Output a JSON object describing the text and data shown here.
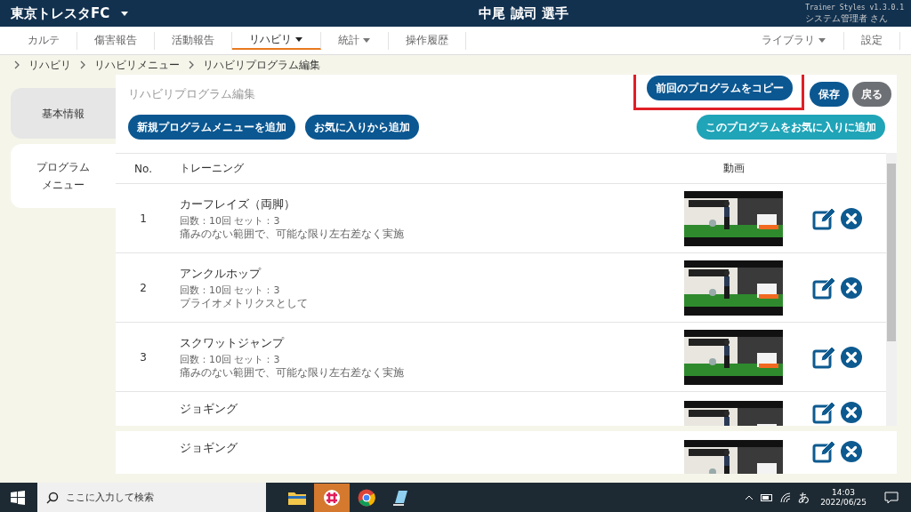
{
  "header": {
    "team": "東京トレスタFC",
    "player": "中尾 誠司 選手",
    "version": "Trainer Styles v1.3.0.1",
    "user": "システム管理者 さん"
  },
  "nav": {
    "left": [
      {
        "label": "カルテ",
        "selected": false,
        "dropdown": false
      },
      {
        "label": "傷害報告",
        "selected": false,
        "dropdown": false
      },
      {
        "label": "活動報告",
        "selected": false,
        "dropdown": false
      },
      {
        "label": "リハビリ",
        "selected": true,
        "dropdown": true
      },
      {
        "label": "統計",
        "selected": false,
        "dropdown": true
      },
      {
        "label": "操作履歴",
        "selected": false,
        "dropdown": false
      }
    ],
    "right": [
      {
        "label": "ライブラリ",
        "selected": false,
        "dropdown": true
      },
      {
        "label": "設定",
        "selected": false,
        "dropdown": false
      }
    ]
  },
  "breadcrumb": [
    "リハビリ",
    "リハビリメニュー",
    "リハビリプログラム編集"
  ],
  "sidebar": {
    "items": [
      {
        "label": "基本情報",
        "selected": false
      },
      {
        "label": "プログラムメニュー",
        "selected": true
      }
    ]
  },
  "panel": {
    "title": "リハビリプログラム編集",
    "top_buttons": [
      {
        "label": "前回のプログラムをコピー",
        "kind": "primary",
        "highlighted": true
      },
      {
        "label": "保存",
        "kind": "primary",
        "highlighted": false
      },
      {
        "label": "戻る",
        "kind": "secondary",
        "highlighted": false
      }
    ],
    "add_buttons": [
      {
        "label": "新規プログラムメニューを追加",
        "kind": "primary"
      },
      {
        "label": "お気に入りから追加",
        "kind": "primary"
      },
      {
        "label": "このプログラムをお気に入りに追加",
        "kind": "accent"
      }
    ],
    "table": {
      "columns": [
        "No.",
        "トレーニング",
        "動画"
      ],
      "rows": [
        {
          "no": "1",
          "name": "カーフレイズ（両脚）",
          "detail": "回数：10回 セット：3",
          "note": "痛みのない範囲で、可能な限り左右差なく実施"
        },
        {
          "no": "2",
          "name": "アンクルホップ",
          "detail": "回数：10回 セット：3",
          "note": "プライオメトリクスとして"
        },
        {
          "no": "3",
          "name": "スクワットジャンプ",
          "detail": "回数：10回 セット：3",
          "note": "痛みのない範囲で、可能な限り左右差なく実施"
        },
        {
          "name": "ジョギング"
        }
      ]
    }
  },
  "lower_panel": {
    "rows": [
      {
        "name": "ジョギング"
      }
    ]
  },
  "taskbar": {
    "search_placeholder": "ここに入力して検索",
    "ime": "あ",
    "time": "14:03",
    "date": "2022/06/25"
  }
}
